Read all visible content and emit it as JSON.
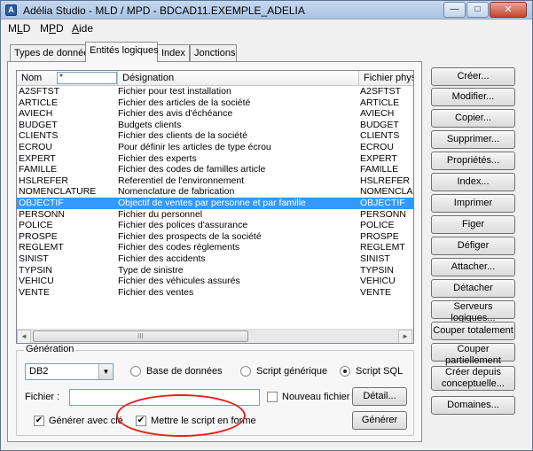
{
  "window": {
    "title": "Adélia Studio - MLD / MPD - BDCAD11.EXEMPLE_ADELIA",
    "minimize_glyph": "—",
    "maximize_glyph": "□",
    "close_glyph": "✕"
  },
  "menu": [
    {
      "label": "MLD",
      "accel_index": 1
    },
    {
      "label": "MPD",
      "accel_index": 1
    },
    {
      "label": "Aide",
      "accel_index": 0
    }
  ],
  "tabs": [
    {
      "label": "Types de donnée",
      "active": false
    },
    {
      "label": "Entités logiques",
      "active": true
    },
    {
      "label": "Index",
      "active": false
    },
    {
      "label": "Jonctions",
      "active": false
    }
  ],
  "list": {
    "columns": [
      "Nom",
      "Désignation",
      "Fichier physique"
    ],
    "filter_value": "*",
    "selected_index": 11,
    "rows": [
      [
        "A2SFTST",
        "Fichier pour test installation",
        "A2SFTST"
      ],
      [
        "ARTICLE",
        "Fichier des articles de la société",
        "ARTICLE"
      ],
      [
        "AVIECH",
        "Fichier des avis d'échéance",
        "AVIECH"
      ],
      [
        "BUDGET",
        "Budgets clients",
        "BUDGET"
      ],
      [
        "CLIENTS",
        "Fichier des clients de la société",
        "CLIENTS"
      ],
      [
        "ECROU",
        "Pour définir les articles de type écrou",
        "ECROU"
      ],
      [
        "EXPERT",
        "Fichier des experts",
        "EXPERT"
      ],
      [
        "FAMILLE",
        "Fichier des codes de familles article",
        "FAMILLE"
      ],
      [
        "HSLREFER",
        "Referentiel de l'environnement",
        "HSLREFER"
      ],
      [
        "NOMENCLATURE",
        "Nomenclature de fabrication",
        "NOMENCLA"
      ],
      [
        "OBJECTIF",
        "Objectif de ventes par personne et par famille",
        "OBJECTIF"
      ],
      [
        "PERSONN",
        "Fichier du personnel",
        "PERSONN"
      ],
      [
        "POLICE",
        "Fichier des polices d'assurance",
        "POLICE"
      ],
      [
        "PROSPE",
        "Fichier des prospects de la société",
        "PROSPE"
      ],
      [
        "REGLEMT",
        "Fichier des codes règlements",
        "REGLEMT"
      ],
      [
        "SINIST",
        "Fichier des accidents",
        "SINIST"
      ],
      [
        "TYPSIN",
        "Type de sinistre",
        "TYPSIN"
      ],
      [
        "VEHICU",
        "Fichier des véhicules assurés",
        "VEHICU"
      ],
      [
        "VENTE",
        "Fichier des ventes",
        "VENTE"
      ]
    ],
    "scroll_left_glyph": "◄",
    "scroll_right_glyph": "►",
    "scroll_thumb_glyph": "III"
  },
  "generation": {
    "legend": "Génération",
    "database_value": "DB2",
    "dropdown_glyph": "▼",
    "radios": [
      {
        "label": "Base de données",
        "checked": false
      },
      {
        "label": "Script générique",
        "checked": false
      },
      {
        "label": "Script SQL",
        "checked": true
      }
    ],
    "file_label": "Fichier :",
    "file_value": "",
    "new_file_label": "Nouveau fichier",
    "new_file_checked": false,
    "detail_button": "Détail...",
    "generate_with_key_label": "Générer avec clé",
    "generate_with_key_checked": true,
    "format_script_label": "Mettre le script en forme",
    "format_script_checked": true,
    "generate_button": "Générer",
    "check_glyph": "✔"
  },
  "side_buttons": [
    "Créer...",
    "Modifier...",
    "Copier...",
    "Supprimer...",
    "Propriétés...",
    "Index...",
    "Imprimer",
    "Figer",
    "Défiger",
    "Attacher...",
    "Détacher",
    "Serveurs logiques...",
    "Couper totalement",
    "Couper partiellement",
    "Créer depuis conceptuelle...",
    "Domaines..."
  ],
  "annotation_color": "#e0221a",
  "selection_color": "#3399ff"
}
